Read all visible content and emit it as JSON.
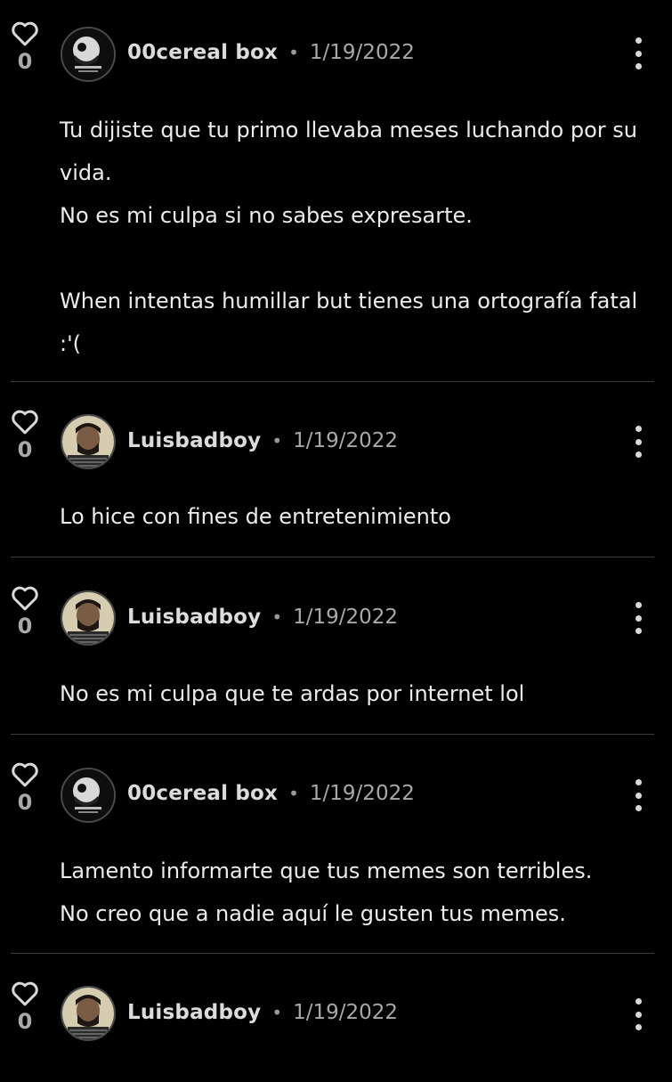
{
  "comments": [
    {
      "likes": "0",
      "username": "00cereal box",
      "date": "1/19/2022",
      "avatar": "cereal-box-avatar",
      "text": "Tu dijiste que tu primo llevaba meses luchando por su vida.\nNo es mi culpa si no sabes expresarte.\n\nWhen intentas humillar but tienes una ortografía fatal :'("
    },
    {
      "likes": "0",
      "username": "Luisbadboy",
      "date": "1/19/2022",
      "avatar": "luisbadboy-avatar",
      "text": "Lo hice con fines de entretenimiento"
    },
    {
      "likes": "0",
      "username": "Luisbadboy",
      "date": "1/19/2022",
      "avatar": "luisbadboy-avatar",
      "text": "No es mi culpa que te ardas por internet lol"
    },
    {
      "likes": "0",
      "username": "00cereal box",
      "date": "1/19/2022",
      "avatar": "cereal-box-avatar",
      "text": "Lamento informarte que tus memes son terribles.\nNo creo que a nadie aquí le gusten tus memes."
    },
    {
      "likes": "0",
      "username": "Luisbadboy",
      "date": "1/19/2022",
      "avatar": "luisbadboy-avatar",
      "text": ""
    }
  ],
  "separator": "•",
  "icons": {
    "like": "heart-outline-icon",
    "more": "vertical-dots-icon"
  },
  "colors": {
    "background": "#000000",
    "text": "#ececec",
    "muted": "#a9a9a9",
    "divider": "#3d3d3d"
  }
}
